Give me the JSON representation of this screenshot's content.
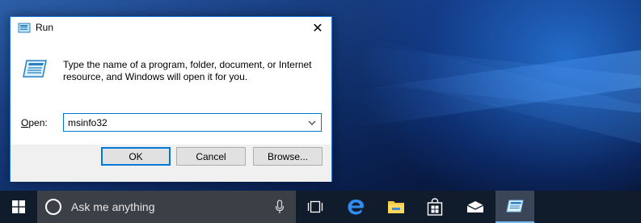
{
  "dialog": {
    "title": "Run",
    "description": "Type the name of a program, folder, document, or Internet resource, and Windows will open it for you.",
    "open_label_prefix": "O",
    "open_label_rest": "pen:",
    "input_value": "msinfo32",
    "close_glyph": "✕",
    "buttons": {
      "ok": "OK",
      "cancel": "Cancel",
      "browse": "Browse..."
    }
  },
  "taskbar": {
    "search_placeholder": "Ask me anything",
    "icons": [
      "start-icon",
      "cortana-icon",
      "microphone-icon",
      "task-view-icon",
      "edge-icon",
      "file-explorer-icon",
      "store-icon",
      "mail-icon",
      "run-icon"
    ]
  },
  "colors": {
    "accent": "#0078d7",
    "taskbar": "#101b2c",
    "search_box": "#3b3f46",
    "dialog_bg": "#f0f0f0"
  }
}
